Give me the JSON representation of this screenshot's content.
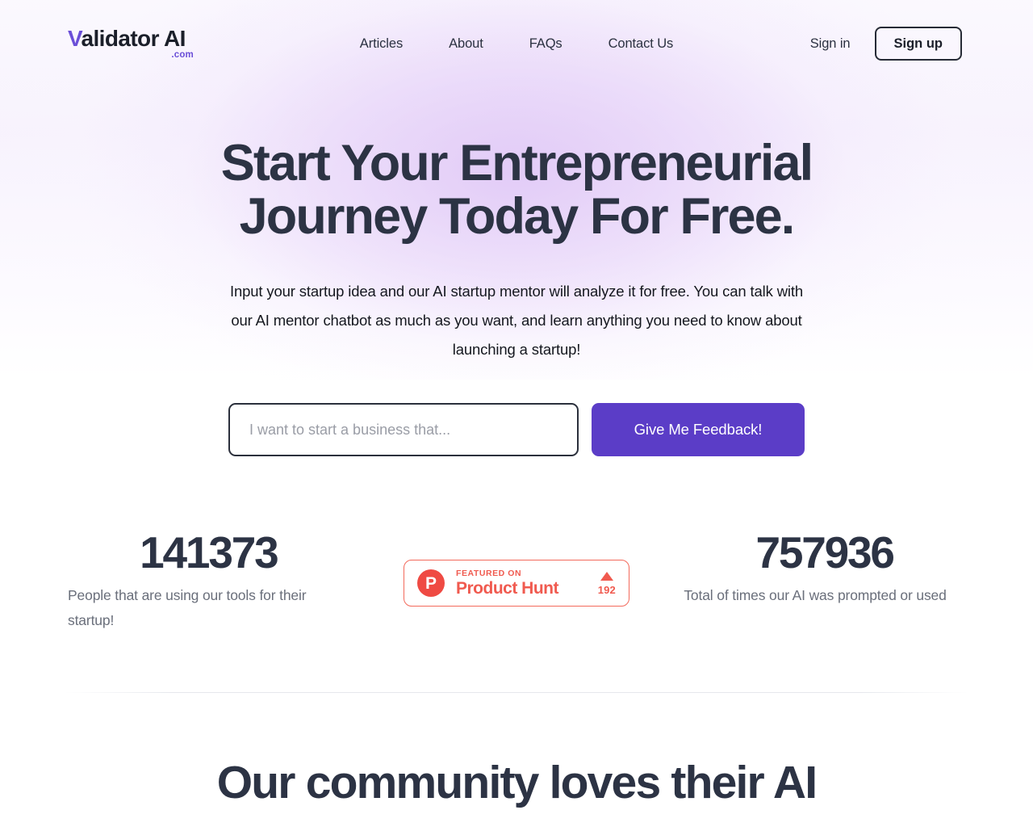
{
  "brand": {
    "name_first_letter": "V",
    "name_rest": "alidator AI",
    "tld": ".com",
    "accent_purple": "#6b4fd8"
  },
  "header": {
    "nav": [
      {
        "label": "Articles",
        "name": "nav-link-articles"
      },
      {
        "label": "About",
        "name": "nav-link-about"
      },
      {
        "label": "FAQs",
        "name": "nav-link-faqs"
      },
      {
        "label": "Contact Us",
        "name": "nav-link-contact-us"
      }
    ],
    "signin_label": "Sign in",
    "signup_label": "Sign up"
  },
  "hero": {
    "title_line_1": "Start Your Entrepreneurial",
    "title_line_2": "Journey Today For Free.",
    "subtitle": "Input your startup idea and our AI startup mentor will analyze it for free. You can talk with our AI mentor chatbot as much as you want, and learn anything you need to know about launching a startup!",
    "input_placeholder": "I want to start a business that...",
    "input_value": "",
    "cta_label": "Give Me Feedback!",
    "cta_color": "#5b3dc7"
  },
  "stats": {
    "left": {
      "value": "141373",
      "label": "People that are using our tools for their startup!"
    },
    "right": {
      "value": "757936",
      "label": "Total of times our AI was prompted or used"
    }
  },
  "product_hunt": {
    "logo_letter": "P",
    "kicker": "FEATURED ON",
    "name": "Product Hunt",
    "vote_count": "192",
    "brand_color": "#f05a4f"
  },
  "community": {
    "title": "Our community loves their AI"
  }
}
